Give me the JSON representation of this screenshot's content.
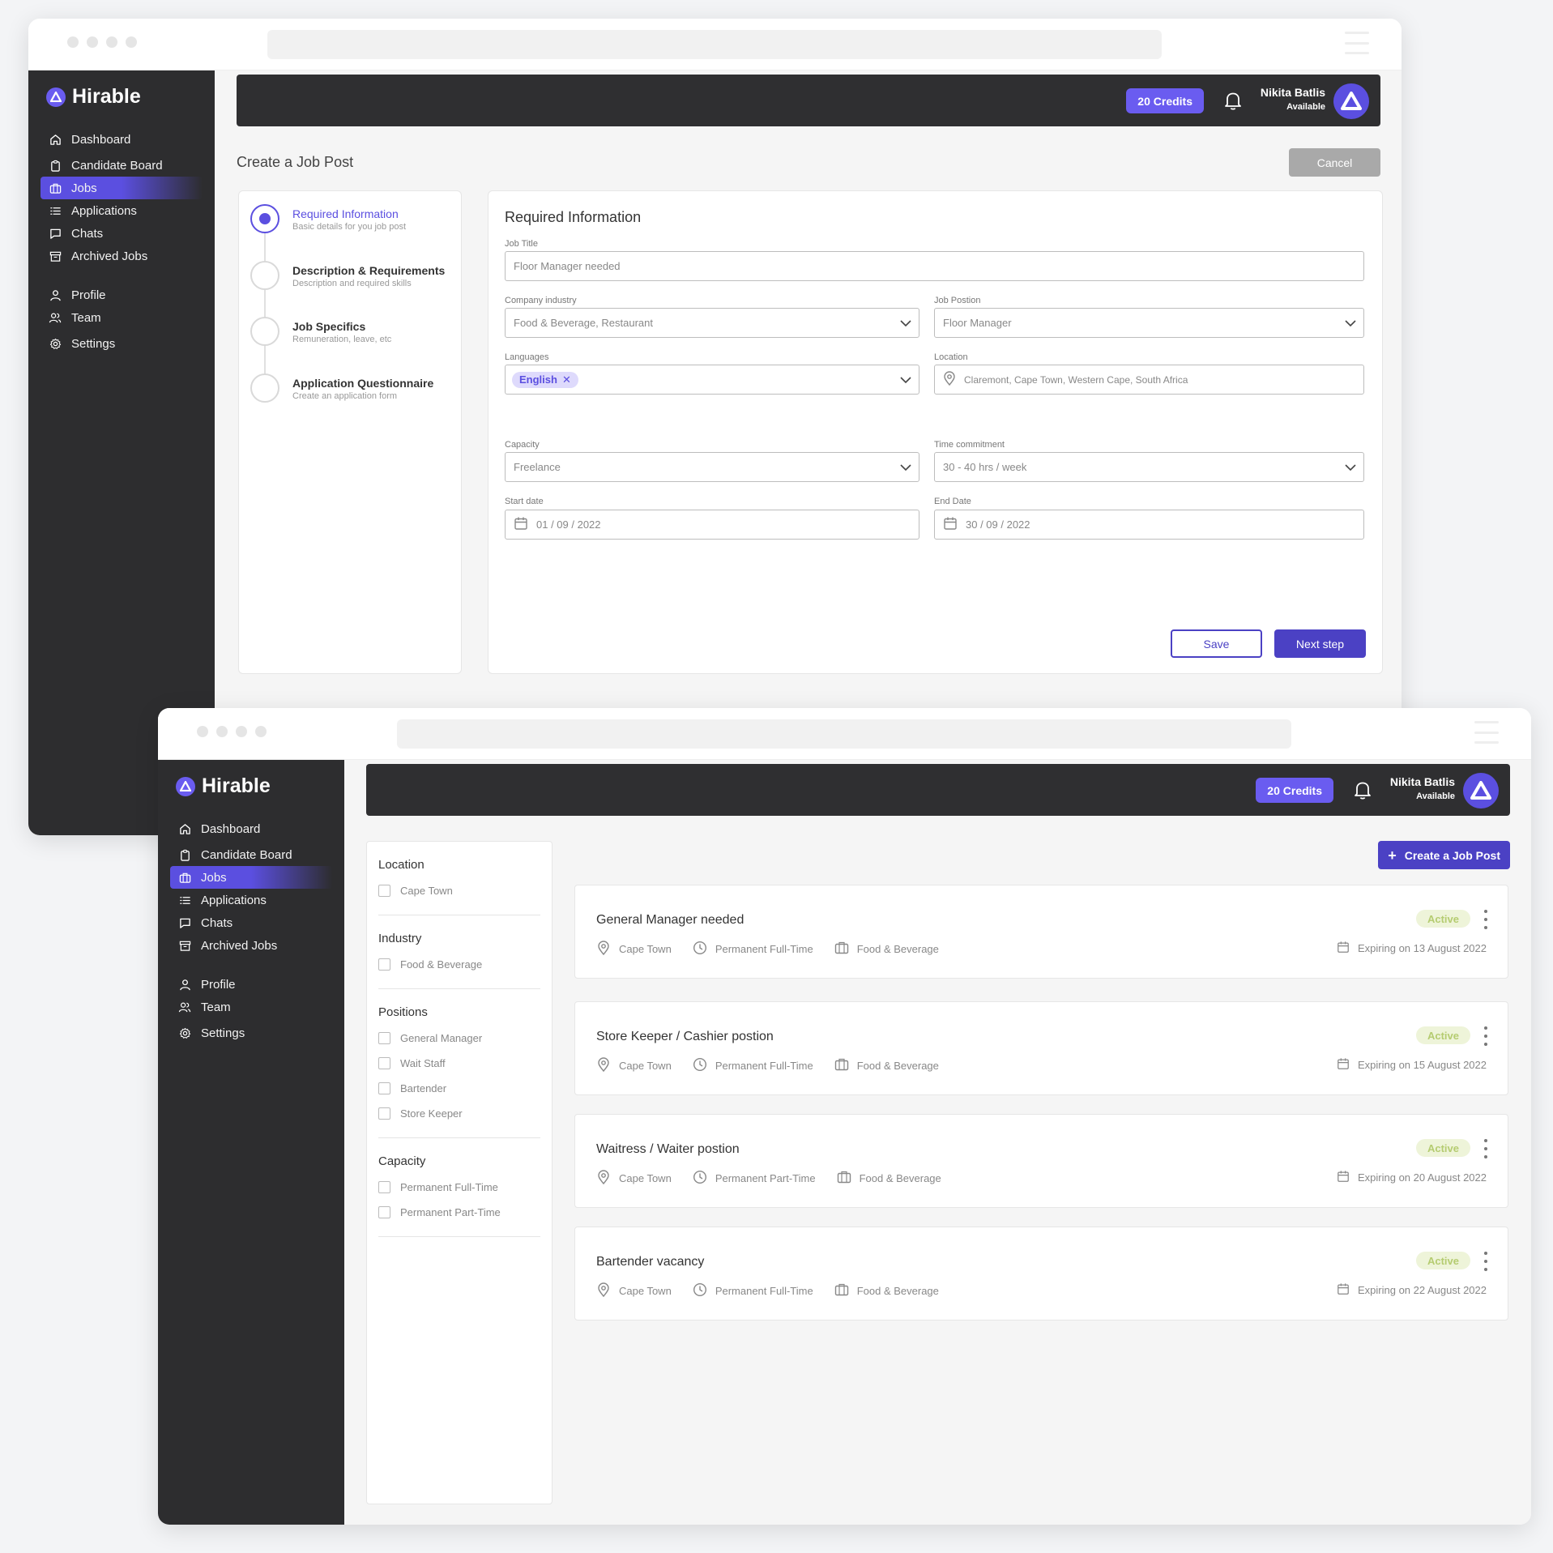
{
  "brand": "Hirable",
  "header": {
    "credits": "20 Credits",
    "user_name": "Nikita Batlis",
    "user_status": "Available"
  },
  "nav": {
    "primary": [
      {
        "label": "Dashboard",
        "icon": "home-icon"
      },
      {
        "label": "Candidate Board",
        "icon": "clipboard-icon"
      },
      {
        "label": "Jobs",
        "icon": "briefcase-icon",
        "active": true
      },
      {
        "label": "Applications",
        "icon": "list-icon"
      },
      {
        "label": "Chats",
        "icon": "chat-icon"
      },
      {
        "label": "Archived Jobs",
        "icon": "archive-icon"
      }
    ],
    "secondary": [
      {
        "label": "Profile",
        "icon": "user-icon"
      },
      {
        "label": "Team",
        "icon": "team-icon"
      },
      {
        "label": "Settings",
        "icon": "gear-icon"
      }
    ]
  },
  "create_post": {
    "page_title": "Create a Job Post",
    "cancel_label": "Cancel",
    "steps": [
      {
        "title": "Required Information",
        "desc": "Basic details for you job post"
      },
      {
        "title": "Description & Requirements",
        "desc": "Description and required skills"
      },
      {
        "title": "Job Specifics",
        "desc": "Remuneration, leave, etc"
      },
      {
        "title": "Application Questionnaire",
        "desc": "Create an application form"
      }
    ],
    "form": {
      "title": "Required Information",
      "job_title_label": "Job Title",
      "job_title_value": "Floor Manager needed",
      "industry_label": "Company industry",
      "industry_value": "Food & Beverage, Restaurant",
      "position_label": "Job Postion",
      "position_value": "Floor Manager",
      "languages_label": "Languages",
      "language_tag": "English",
      "location_label": "Location",
      "location_value": "Claremont, Cape Town, Western Cape, South Africa",
      "capacity_label": "Capacity",
      "capacity_value": "Freelance",
      "time_label": "Time commitment",
      "time_value": "30 - 40 hrs / week",
      "start_label": "Start date",
      "start_value": "01 / 09 / 2022",
      "end_label": "End Date",
      "end_value": "30 / 09 / 2022",
      "save_label": "Save",
      "next_label": "Next step"
    }
  },
  "jobs_page": {
    "create_label": "Create a Job Post",
    "filters": {
      "location": {
        "title": "Location",
        "options": [
          "Cape Town"
        ]
      },
      "industry": {
        "title": "Industry",
        "options": [
          "Food & Beverage"
        ]
      },
      "positions": {
        "title": "Positions",
        "options": [
          "General Manager",
          "Wait Staff",
          "Bartender",
          "Store Keeper"
        ]
      },
      "capacity": {
        "title": "Capacity",
        "options": [
          "Permanent Full-Time",
          "Permanent Part-Time"
        ]
      }
    },
    "jobs": [
      {
        "title": "General Manager needed",
        "location": "Cape Town",
        "capacity": "Permanent Full-Time",
        "industry": "Food & Beverage",
        "status": "Active",
        "expiry": "Expiring on 13 August 2022"
      },
      {
        "title": "Store Keeper / Cashier postion",
        "location": "Cape Town",
        "capacity": "Permanent Full-Time",
        "industry": "Food & Beverage",
        "status": "Active",
        "expiry": "Expiring on 15 August 2022"
      },
      {
        "title": "Waitress / Waiter postion",
        "location": "Cape Town",
        "capacity": "Permanent Part-Time",
        "industry": "Food & Beverage",
        "status": "Active",
        "expiry": "Expiring on 20 August 2022"
      },
      {
        "title": "Bartender vacancy",
        "location": "Cape Town",
        "capacity": "Permanent Full-Time",
        "industry": "Food & Beverage",
        "status": "Active",
        "expiry": "Expiring on 22 August 2022"
      }
    ]
  },
  "colors": {
    "accent": "#5b4fe0",
    "accent_dark": "#4b41c4",
    "sidebar": "#2d2d2f",
    "active_badge_bg": "#eef4d9",
    "active_badge_text": "#b5cc71"
  }
}
